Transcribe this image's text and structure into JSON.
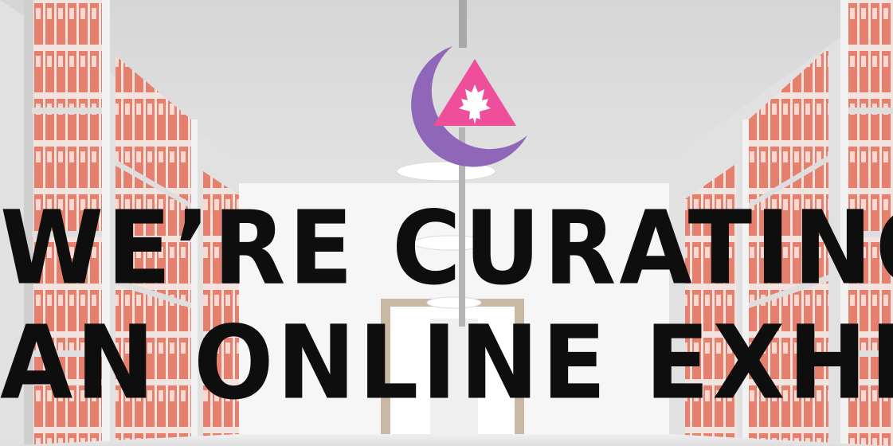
{
  "headline": {
    "line1": "WE’RE CURATING",
    "line2": "AN ONLINE EXHIBIT"
  },
  "logo": {
    "icon": "crescent-triangle-maple-leaf-logo"
  },
  "colors": {
    "text": "#0e0e0e",
    "crescent": "#9067b8",
    "triangle": "#ef4f9a",
    "binder": "#e5806e",
    "shelf": "#dcdcdc",
    "ceiling": "#e9e9e9"
  }
}
